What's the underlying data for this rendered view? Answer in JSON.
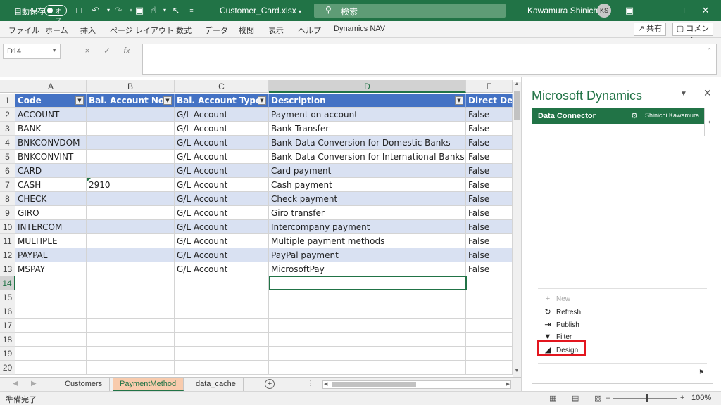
{
  "titlebar": {
    "autosave_label": "自動保存",
    "autosave_state": "オフ",
    "filename": "Customer_Card.xlsx",
    "search_placeholder": "検索",
    "user_name": "Kawamura Shinichi",
    "user_initials": "KS"
  },
  "ribbon": {
    "tabs": [
      "ファイル",
      "ホーム",
      "挿入",
      "ページ レイアウト",
      "数式",
      "データ",
      "校閲",
      "表示",
      "ヘルプ",
      "Dynamics NAV"
    ],
    "share": "共有",
    "comment": "コメント"
  },
  "formula_bar": {
    "name_box": "D14",
    "cancel_icon": "×",
    "enter_icon": "✓",
    "fx_label": "fx",
    "formula": ""
  },
  "grid": {
    "columns": [
      "A",
      "B",
      "C",
      "D",
      "E"
    ],
    "headers": [
      "Code",
      "Bal. Account No.",
      "Bal. Account Type",
      "Description",
      "Direct Deb"
    ],
    "rows": [
      [
        "ACCOUNT",
        "",
        "G/L Account",
        "Payment on account",
        "False"
      ],
      [
        "BANK",
        "",
        "G/L Account",
        "Bank Transfer",
        "False"
      ],
      [
        "BNKCONVDOM",
        "",
        "G/L Account",
        "Bank Data Conversion for Domestic Banks",
        "False"
      ],
      [
        "BNKCONVINT",
        "",
        "G/L Account",
        "Bank Data Conversion for International Banks",
        "False"
      ],
      [
        "CARD",
        "",
        "G/L Account",
        "Card payment",
        "False"
      ],
      [
        "CASH",
        "2910",
        "G/L Account",
        "Cash payment",
        "False"
      ],
      [
        "CHECK",
        "",
        "G/L Account",
        "Check payment",
        "False"
      ],
      [
        "GIRO",
        "",
        "G/L Account",
        "Giro transfer",
        "False"
      ],
      [
        "INTERCOM",
        "",
        "G/L Account",
        "Intercompany payment",
        "False"
      ],
      [
        "MULTIPLE",
        "",
        "G/L Account",
        "Multiple payment methods",
        "False"
      ],
      [
        "PAYPAL",
        "",
        "G/L Account",
        "PayPal payment",
        "False"
      ],
      [
        "MSPAY",
        "",
        "G/L Account",
        "MicrosoftPay",
        "False"
      ]
    ],
    "row_numbers": [
      "1",
      "2",
      "3",
      "4",
      "5",
      "6",
      "7",
      "8",
      "9",
      "10",
      "11",
      "12",
      "13",
      "14",
      "15",
      "16",
      "17",
      "18",
      "19",
      "20"
    ],
    "selected_cell": "D14"
  },
  "sheets": {
    "tabs": [
      "Customers",
      "PaymentMethod",
      "data_cache"
    ],
    "active": "PaymentMethod"
  },
  "statusbar": {
    "ready": "準備完了",
    "zoom": "100%"
  },
  "pane": {
    "title": "Microsoft Dynamics",
    "connector_title": "Data Connector",
    "connector_user": "Shinichi Kawamura",
    "actions": [
      {
        "label": "New",
        "icon": "plus-icon",
        "enabled": false
      },
      {
        "label": "Refresh",
        "icon": "refresh-icon",
        "enabled": true
      },
      {
        "label": "Publish",
        "icon": "publish-icon",
        "enabled": true
      },
      {
        "label": "Filter",
        "icon": "filter-icon",
        "enabled": true
      },
      {
        "label": "Design",
        "icon": "design-icon",
        "enabled": true
      }
    ]
  },
  "colors": {
    "excel_green": "#217346",
    "table_header": "#4472c4",
    "band_row": "#d9e1f2",
    "highlight_red": "#e3161f"
  }
}
